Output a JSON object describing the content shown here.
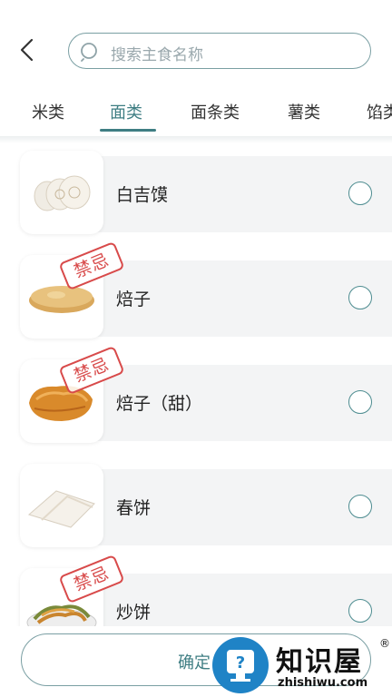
{
  "search": {
    "placeholder": "搜索主食名称"
  },
  "tabs": [
    {
      "label": "米类"
    },
    {
      "label": "面类"
    },
    {
      "label": "面条类"
    },
    {
      "label": "薯类"
    },
    {
      "label": "馅类"
    }
  ],
  "active_tab": "面类",
  "items": [
    {
      "name": "白吉馍",
      "forbidden": false,
      "selected": false,
      "image": "baijimo-food-image"
    },
    {
      "name": "焙子",
      "forbidden": true,
      "selected": false,
      "image": "beizi-food-image"
    },
    {
      "name": "焙子（甜）",
      "forbidden": true,
      "selected": false,
      "image": "sweet-beizi-food-image"
    },
    {
      "name": "春饼",
      "forbidden": false,
      "selected": false,
      "image": "spring-pancake-food-image"
    },
    {
      "name": "炒饼",
      "forbidden": true,
      "selected": false,
      "image": "fried-pancake-food-image"
    }
  ],
  "badge_label": "禁忌",
  "confirm_label": "确定",
  "watermark": {
    "title": "知识屋",
    "reg": "®",
    "subtitle": "zhishiwu.com"
  },
  "colors": {
    "accent": "#3f7e83",
    "forbidden": "#d84a4a",
    "radio": "#4d8c90"
  }
}
